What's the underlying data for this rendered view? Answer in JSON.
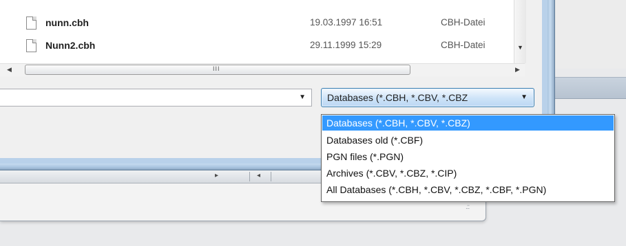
{
  "files": [
    {
      "name": "nunn.cbh",
      "date": "19.03.1997 16:51",
      "type": "CBH-Datei"
    },
    {
      "name": "Nunn2.cbh",
      "date": "29.11.1999 15:29",
      "type": "CBH-Datei"
    }
  ],
  "scrollbar": {
    "grip": "III"
  },
  "filename_field": {
    "value": ""
  },
  "file_type_combo": {
    "selected": "Databases (*.CBH, *.CBV, *.CBZ"
  },
  "file_type_options": [
    "Databases (*.CBH, *.CBV, *.CBZ)",
    "Databases old (*.CBF)",
    "PGN files (*.PGN)",
    "Archives (*.CBV, *.CBZ, *.CIP)",
    "All Databases (*.CBH, *.CBV, *.CBZ, *.CBF, *.PGN)"
  ],
  "selected_option_index": 0,
  "colors": {
    "highlight": "#3399ff",
    "window_frame": "#b9d1ea"
  }
}
